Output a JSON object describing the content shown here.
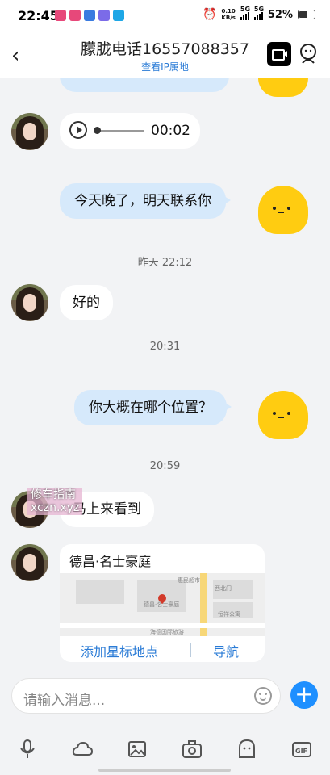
{
  "status": {
    "time": "22:45",
    "net_speed": "0.10",
    "net_unit": "KB/s",
    "sig1": "5G",
    "sig2": "5G",
    "battery": "52%"
  },
  "header": {
    "title": "朦胧电话16557088357",
    "subtitle": "查看IP属地"
  },
  "messages": {
    "voice_duration": "00:02",
    "out1": "今天晚了，明天联系你",
    "ts1": "昨天 22:12",
    "in1": "好的",
    "ts2": "20:31",
    "out2": "你大概在哪个位置？",
    "ts3": "20:59",
    "in2": "马上来看到",
    "watermark_line1": "修车指南",
    "watermark_line2": "xczn.xyz"
  },
  "location": {
    "name": "德昌·名士豪庭",
    "add_star": "添加星标地点",
    "navigate": "导航",
    "map_labels": [
      "惠民超市",
      "西北门",
      "恒祥公寓",
      "海德国际旅游",
      "德昌·名士豪庭"
    ]
  },
  "composer": {
    "placeholder": "请输入消息..."
  },
  "toolbar": {
    "icons": [
      "mic-icon",
      "cloud-icon",
      "image-icon",
      "camera-icon",
      "sticker-icon",
      "gif-icon"
    ]
  }
}
